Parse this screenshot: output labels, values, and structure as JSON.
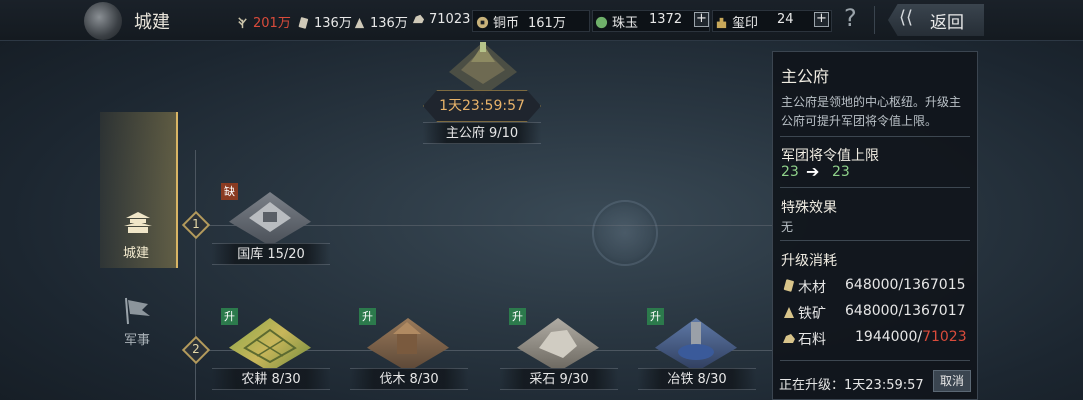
{
  "header": {
    "title": "城建",
    "resources": [
      {
        "icon": "grain-icon",
        "value": "201万",
        "color": "#d94b3b"
      },
      {
        "icon": "wood-icon",
        "value": "136万",
        "color": "#e8e8e8"
      },
      {
        "icon": "iron-icon",
        "value": "136万",
        "color": "#e8e8e8"
      },
      {
        "icon": "stone-icon",
        "value": "71023",
        "color": "#e8e8e8"
      }
    ],
    "copper": {
      "label": "铜币",
      "value": "161万"
    },
    "jade": {
      "label": "珠玉",
      "value": "1372"
    },
    "seal": {
      "label": "玺印",
      "value": "24"
    },
    "plus": "+",
    "help": "?",
    "back_label": "返回",
    "back_arrow": "⟨⟨"
  },
  "nav": [
    {
      "label": "城建",
      "active": true
    },
    {
      "label": "军事",
      "active": false
    }
  ],
  "tiers": [
    "1",
    "2"
  ],
  "main_building": {
    "timer": "1天23:59:57",
    "label": "主公府 9/10"
  },
  "buildings": [
    {
      "label": "国库 15/20",
      "tag": "缺"
    },
    {
      "label": "农耕 8/30",
      "tag": "升"
    },
    {
      "label": "伐木 8/30",
      "tag": "升"
    },
    {
      "label": "采石 9/30",
      "tag": "升"
    },
    {
      "label": "冶铁 8/30",
      "tag": "升"
    }
  ],
  "panel": {
    "title": "主公府",
    "desc_line1": "主公府是领地的中心枢纽。升级主",
    "desc_line2": "公府可提升军团将令值上限。",
    "cap_title": "军团将令值上限",
    "cap_from": "23",
    "cap_arrow": "➔",
    "cap_to": "23",
    "effect_title": "特殊效果",
    "effect_value": "无",
    "cost_title": "升级消耗",
    "costs": [
      {
        "icon": "wood-icon",
        "name": "木材",
        "value": "648000/1367015"
      },
      {
        "icon": "iron-icon",
        "name": "铁矿",
        "value": "648000/1367017"
      },
      {
        "icon": "stone-icon",
        "name": "石料",
        "have": "1944000/",
        "need": "71023",
        "need_color": "#d94b3b"
      }
    ],
    "upgrading_label": "正在升级：1天23:59:57",
    "cancel_label": "取消"
  },
  "colors": {
    "accent_gold": "#d9b565",
    "value_green": "#8fd18a",
    "warning_red": "#d94b3b"
  }
}
